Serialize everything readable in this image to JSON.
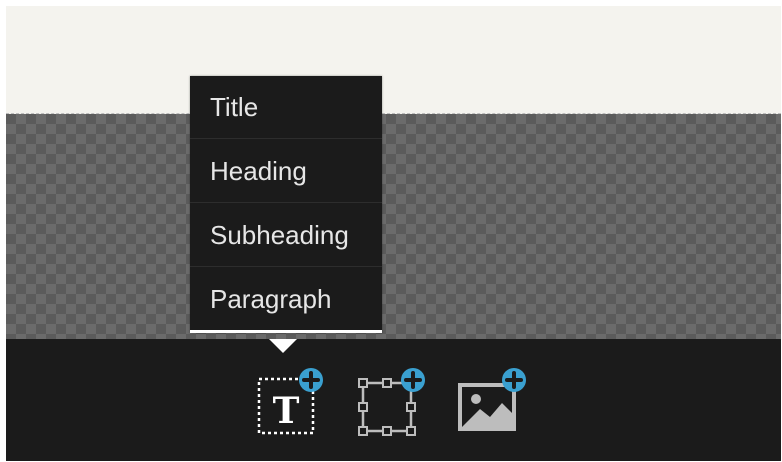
{
  "text_menu": {
    "items": [
      {
        "label": "Title"
      },
      {
        "label": "Heading"
      },
      {
        "label": "Subheading"
      },
      {
        "label": "Paragraph"
      }
    ]
  },
  "toolbar": {
    "tools": [
      {
        "icon": "text-add-icon",
        "glyph": "T"
      },
      {
        "icon": "box-add-icon"
      },
      {
        "icon": "image-add-icon"
      }
    ]
  },
  "colors": {
    "top_area_bg": "#f4f3ee",
    "canvas_checker_dark": "#5b5b5b",
    "canvas_checker_light": "#6b6b6b",
    "toolbar_bg": "#1b1b1b",
    "menu_text": "#e6e6e6",
    "plus_badge": "#3aa0d0"
  }
}
